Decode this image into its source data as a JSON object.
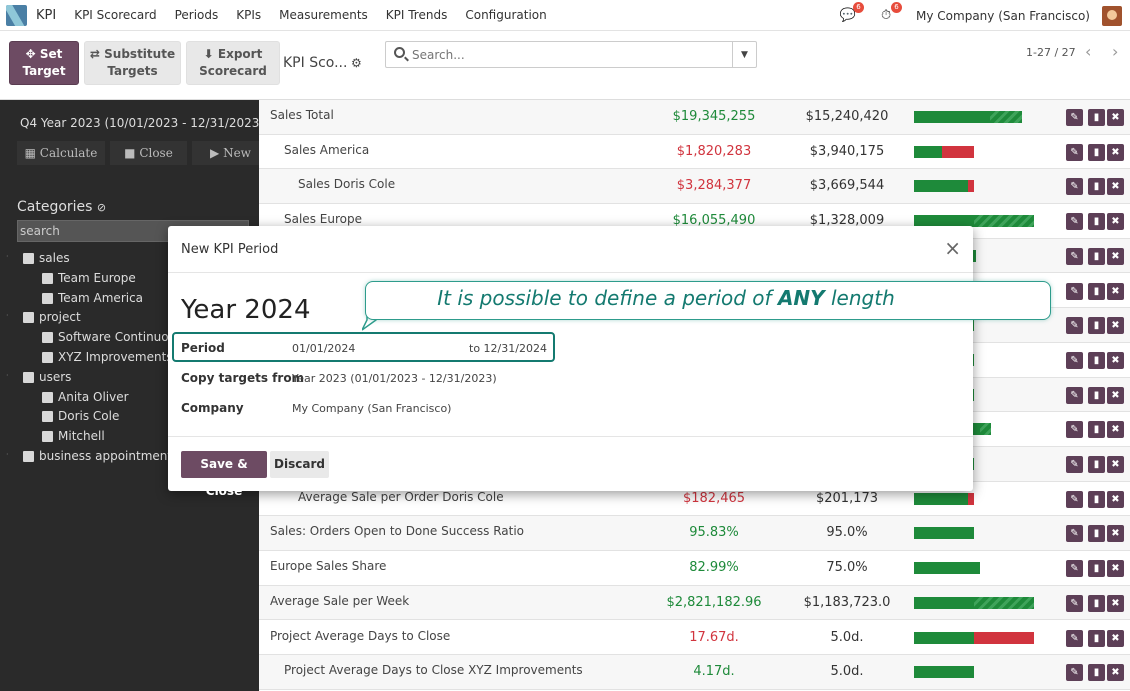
{
  "nav": {
    "app_name": "KPI",
    "menu": [
      "KPI Scorecard",
      "Periods",
      "KPIs",
      "Measurements",
      "KPI Trends",
      "Configuration"
    ],
    "messages_count": "6",
    "activities_count": "6",
    "company": "My Company (San Francisco)"
  },
  "control_panel": {
    "set_target_label": "Set Target",
    "substitute_label": "Substitute Targets",
    "export_label": "Export Scorecard",
    "view_title": "KPI Sco...",
    "search_placeholder": "Search...",
    "pager": "1-27 / 27"
  },
  "sidebar": {
    "period": "Q4 Year 2023 (10/01/2023 - 12/31/2023)",
    "calculate": "Calculate",
    "close": "Close",
    "new": "New",
    "categories_title": "Categories",
    "search_value": "search",
    "tree": [
      {
        "label": "sales",
        "level": 0
      },
      {
        "label": "Team Europe",
        "level": 1
      },
      {
        "label": "Team America",
        "level": 1
      },
      {
        "label": "project",
        "level": 0
      },
      {
        "label": "Software Continuous",
        "level": 1
      },
      {
        "label": "XYZ Improvements",
        "level": 1
      },
      {
        "label": "users",
        "level": 0
      },
      {
        "label": "Anita Oliver",
        "level": 1
      },
      {
        "label": "Doris Cole",
        "level": 1
      },
      {
        "label": "Mitchell",
        "level": 1
      },
      {
        "label": "business appointments",
        "level": 0
      }
    ]
  },
  "table": {
    "rows": [
      {
        "name": "Sales Total",
        "indent": 0,
        "actual": "$19,345,255",
        "target": "$15,240,420",
        "status": "good",
        "green": 0.63,
        "red": 0,
        "over": 0.27
      },
      {
        "name": "Sales America",
        "indent": 1,
        "actual": "$1,820,283",
        "target": "$3,940,175",
        "status": "bad",
        "green": 0.23,
        "red": 0.27,
        "over": 0
      },
      {
        "name": "Sales Doris Cole",
        "indent": 2,
        "actual": "$3,284,377",
        "target": "$3,669,544",
        "status": "bad",
        "green": 0.45,
        "red": 0.05,
        "over": 0
      },
      {
        "name": "Sales Europe",
        "indent": 1,
        "actual": "$16,055,490",
        "target": "$1,328,009",
        "status": "good",
        "green": 0.5,
        "red": 0,
        "over": 0.5
      },
      {
        "name": "",
        "indent": 0,
        "actual": "",
        "target": "",
        "status": "good",
        "green": 0.52,
        "red": 0,
        "over": 0
      },
      {
        "name": "",
        "indent": 0,
        "actual": "",
        "target": "",
        "status": "good",
        "green": 0.47,
        "red": 0,
        "over": 0
      },
      {
        "name": "",
        "indent": 0,
        "actual": "",
        "target": "",
        "status": "good",
        "green": 0.5,
        "red": 0,
        "over": 0
      },
      {
        "name": "",
        "indent": 0,
        "actual": "",
        "target": "",
        "status": "good",
        "green": 0.5,
        "red": 0,
        "over": 0
      },
      {
        "name": "",
        "indent": 0,
        "actual": "",
        "target": "",
        "status": "good",
        "green": 0.5,
        "red": 0,
        "over": 0
      },
      {
        "name": "",
        "indent": 0,
        "actual": "",
        "target": "",
        "status": "good",
        "green": 0.55,
        "red": 0,
        "over": 0.09
      },
      {
        "name": "",
        "indent": 0,
        "actual": "",
        "target": "",
        "status": "good",
        "green": 0.5,
        "red": 0,
        "over": 0
      },
      {
        "name": "Average Sale per Order Doris Cole",
        "indent": 2,
        "actual": "$182,465",
        "target": "$201,173",
        "status": "bad",
        "green": 0.45,
        "red": 0.05,
        "over": 0
      },
      {
        "name": "Sales: Orders Open to Done Success Ratio",
        "indent": 0,
        "actual": "95.83%",
        "target": "95.0%",
        "status": "good",
        "green": 0.5,
        "red": 0,
        "over": 0
      },
      {
        "name": "Europe Sales Share",
        "indent": 0,
        "actual": "82.99%",
        "target": "75.0%",
        "status": "good",
        "green": 0.55,
        "red": 0,
        "over": 0
      },
      {
        "name": "Average Sale per Week",
        "indent": 0,
        "actual": "$2,821,182.96",
        "target": "$1,183,723.0",
        "status": "good",
        "green": 0.5,
        "red": 0,
        "over": 0.5
      },
      {
        "name": "Project Average Days to Close",
        "indent": 0,
        "actual": "17.67d.",
        "target": "5.0d.",
        "status": "bad",
        "green": 0.5,
        "red": 0.5,
        "over": 0
      },
      {
        "name": "Project Average Days to Close XYZ Improvements",
        "indent": 1,
        "actual": "4.17d.",
        "target": "5.0d.",
        "status": "good",
        "green": 0.5,
        "red": 0,
        "over": 0
      }
    ]
  },
  "modal": {
    "title": "New KPI Period",
    "name": "Year 2024",
    "period_label": "Period",
    "date_from": "01/01/2024",
    "date_to": "to 12/31/2024",
    "copy_label": "Copy targets from",
    "copy_value": "Year 2023 (01/01/2023 - 12/31/2023)",
    "company_label": "Company",
    "company_value": "My Company (San Francisco)",
    "save_label": "Save & Close",
    "discard_label": "Discard"
  },
  "callout": {
    "text_before": "It is possible to define a period of ",
    "text_bold": "ANY",
    "text_after": " length"
  },
  "colors": {
    "primary": "#6d4b63",
    "good": "#1e8a3a",
    "bad": "#d1343e",
    "callout": "#147a70"
  }
}
